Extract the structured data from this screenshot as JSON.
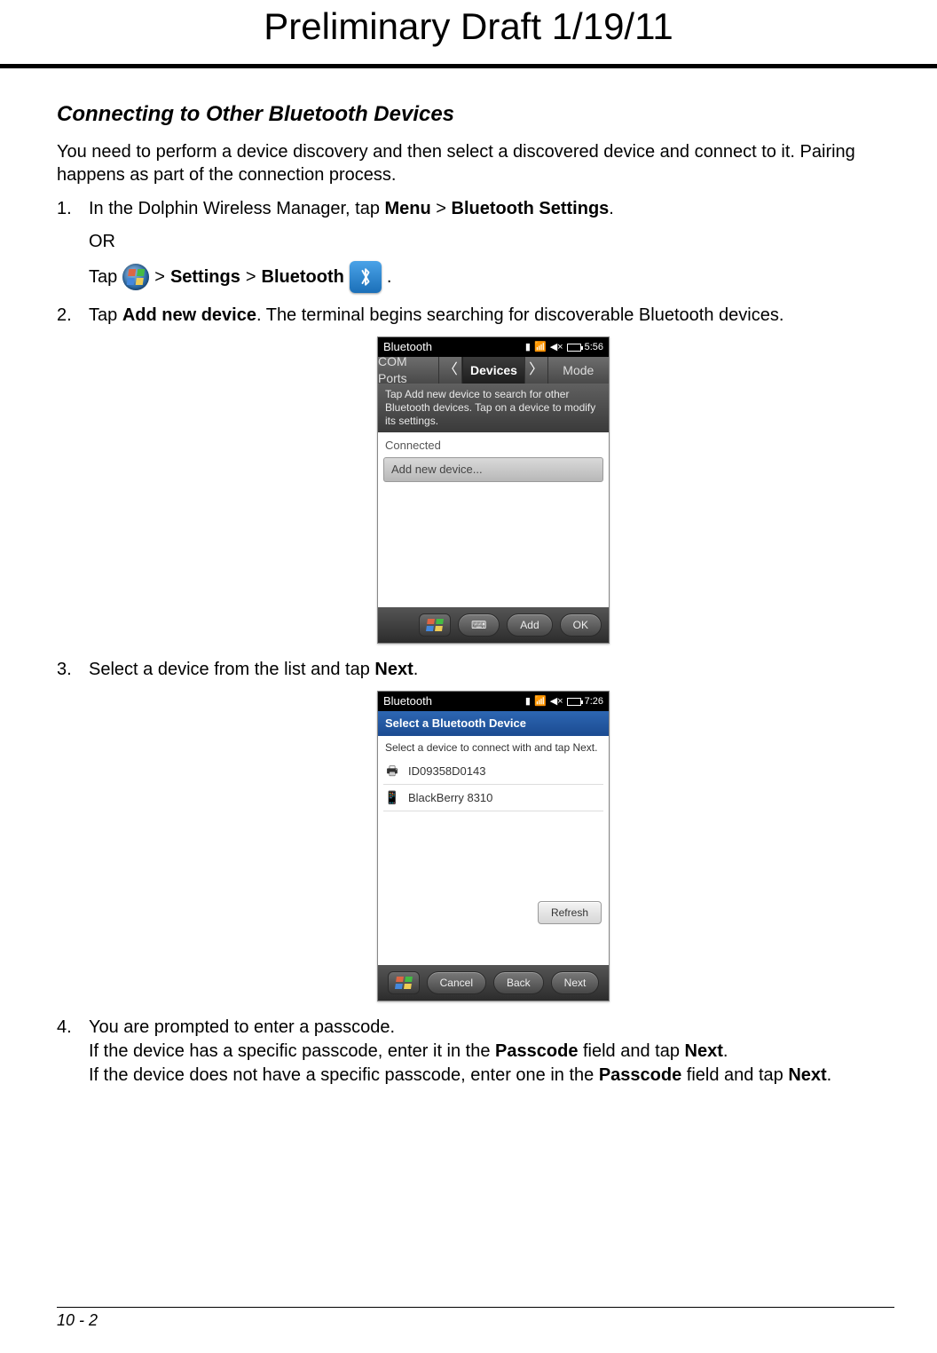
{
  "draft_header": "Preliminary Draft 1/19/11",
  "section_heading": "Connecting to Other Bluetooth Devices",
  "intro": "You need to perform a device discovery and then select a discovered device and connect to it. Pairing happens as part of the connection process.",
  "step1": {
    "prefix": "In the Dolphin Wireless Manager, tap ",
    "menu": "Menu",
    "gt1": " > ",
    "bt_settings": "Bluetooth Settings",
    "suffix": ".",
    "or": "OR",
    "tap": "Tap ",
    "gt2": " > ",
    "settings": "Settings",
    "gt3": " > ",
    "bluetooth": "Bluetooth",
    "period": " ."
  },
  "step2": {
    "prefix": "Tap ",
    "add_new": "Add new device",
    "suffix": ". The terminal begins searching for discoverable Bluetooth devices."
  },
  "step3": {
    "prefix": "Select a device from the list and tap ",
    "next": "Next",
    "suffix": "."
  },
  "step4": {
    "line1": "You are prompted to enter a passcode.",
    "line2a": "If the device has a specific passcode, enter it in the ",
    "passcode1": "Passcode",
    "line2b": " field and tap ",
    "next1": "Next",
    "line2c": ".",
    "line3a": "If the device does not have a specific passcode, enter one in the ",
    "passcode2": "Passcode",
    "line3b": " field and tap ",
    "next2": "Next",
    "line3c": "."
  },
  "screen1": {
    "title": "Bluetooth",
    "time": "5:56",
    "tab_left": "COM Ports",
    "tab_mid": "Devices",
    "tab_right": "Mode",
    "hint": "Tap Add new device to search for other Bluetooth devices. Tap on a device to modify its settings.",
    "connected": "Connected",
    "add_row": "Add new device...",
    "btn_add": "Add",
    "btn_ok": "OK"
  },
  "screen2": {
    "title": "Bluetooth",
    "time": "7:26",
    "blue_header": "Select a Bluetooth Device",
    "sub_hint": "Select a device to connect with and tap Next.",
    "item1": "ID09358D0143",
    "item2": "BlackBerry 8310",
    "refresh": "Refresh",
    "btn_cancel": "Cancel",
    "btn_back": "Back",
    "btn_next": "Next"
  },
  "footer": "10 - 2"
}
